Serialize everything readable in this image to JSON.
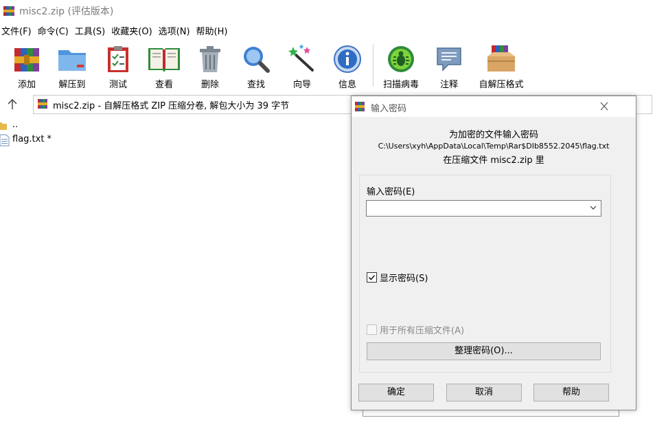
{
  "window": {
    "title": "misc2.zip (评估版本)"
  },
  "menu": [
    "文件(F)",
    "命令(C)",
    "工具(S)",
    "收藏夹(O)",
    "选项(N)",
    "帮助(H)"
  ],
  "toolbar": [
    "添加",
    "解压到",
    "测试",
    "查看",
    "删除",
    "查找",
    "向导",
    "信息",
    "扫描病毒",
    "注释",
    "自解压格式"
  ],
  "address": {
    "text": "misc2.zip - 自解压格式 ZIP 压缩分卷, 解包大小为 39 字节"
  },
  "files": [
    {
      "name": ".."
    },
    {
      "name": "flag.txt *"
    }
  ],
  "dialog": {
    "title": "输入密码",
    "heading": "为加密的文件输入密码",
    "path": "C:\\Users\\xyh\\AppData\\Local\\Temp\\Rar$DIb8552.2045\\flag.txt",
    "in_archive": "在压缩文件 misc2.zip 里",
    "password_label": "输入密码(E)",
    "password_value": "",
    "show_password_label": "显示密码(S)",
    "show_password_checked": true,
    "use_all_label": "用于所有压缩文件(A)",
    "organize_button": "整理密码(O)...",
    "ok_button": "确定",
    "cancel_button": "取消",
    "help_button": "帮助"
  }
}
